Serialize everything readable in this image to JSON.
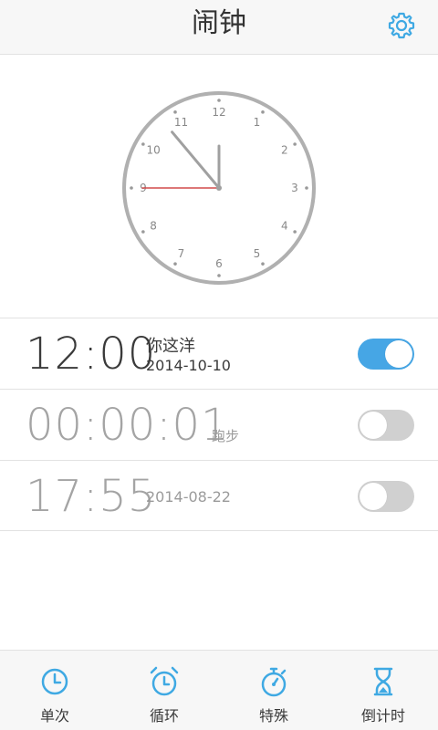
{
  "header": {
    "title": "闹钟",
    "accent_color": "#3fa9e3"
  },
  "clock": {
    "numbers": [
      "12",
      "1",
      "2",
      "3",
      "4",
      "5",
      "6",
      "7",
      "8",
      "9",
      "10",
      "11"
    ],
    "hour_hand_angle_deg": 0,
    "minute_hand_angle_deg": -40,
    "second_hand_angle_deg": -90,
    "second_hand_color": "#d24b4b"
  },
  "alarms": [
    {
      "time": "12:00",
      "label": "你这洋",
      "date": "2014-10-10",
      "enabled": true
    },
    {
      "time": "00:00:01",
      "label": "跑步",
      "date": "",
      "enabled": false
    },
    {
      "time": "17:55",
      "label": "",
      "date": "2014-08-22",
      "enabled": false
    }
  ],
  "nav": [
    {
      "label": "单次",
      "icon": "clock-icon"
    },
    {
      "label": "循环",
      "icon": "alarm-clock-icon"
    },
    {
      "label": "特殊",
      "icon": "stopwatch-icon"
    },
    {
      "label": "倒计时",
      "icon": "hourglass-icon"
    }
  ]
}
